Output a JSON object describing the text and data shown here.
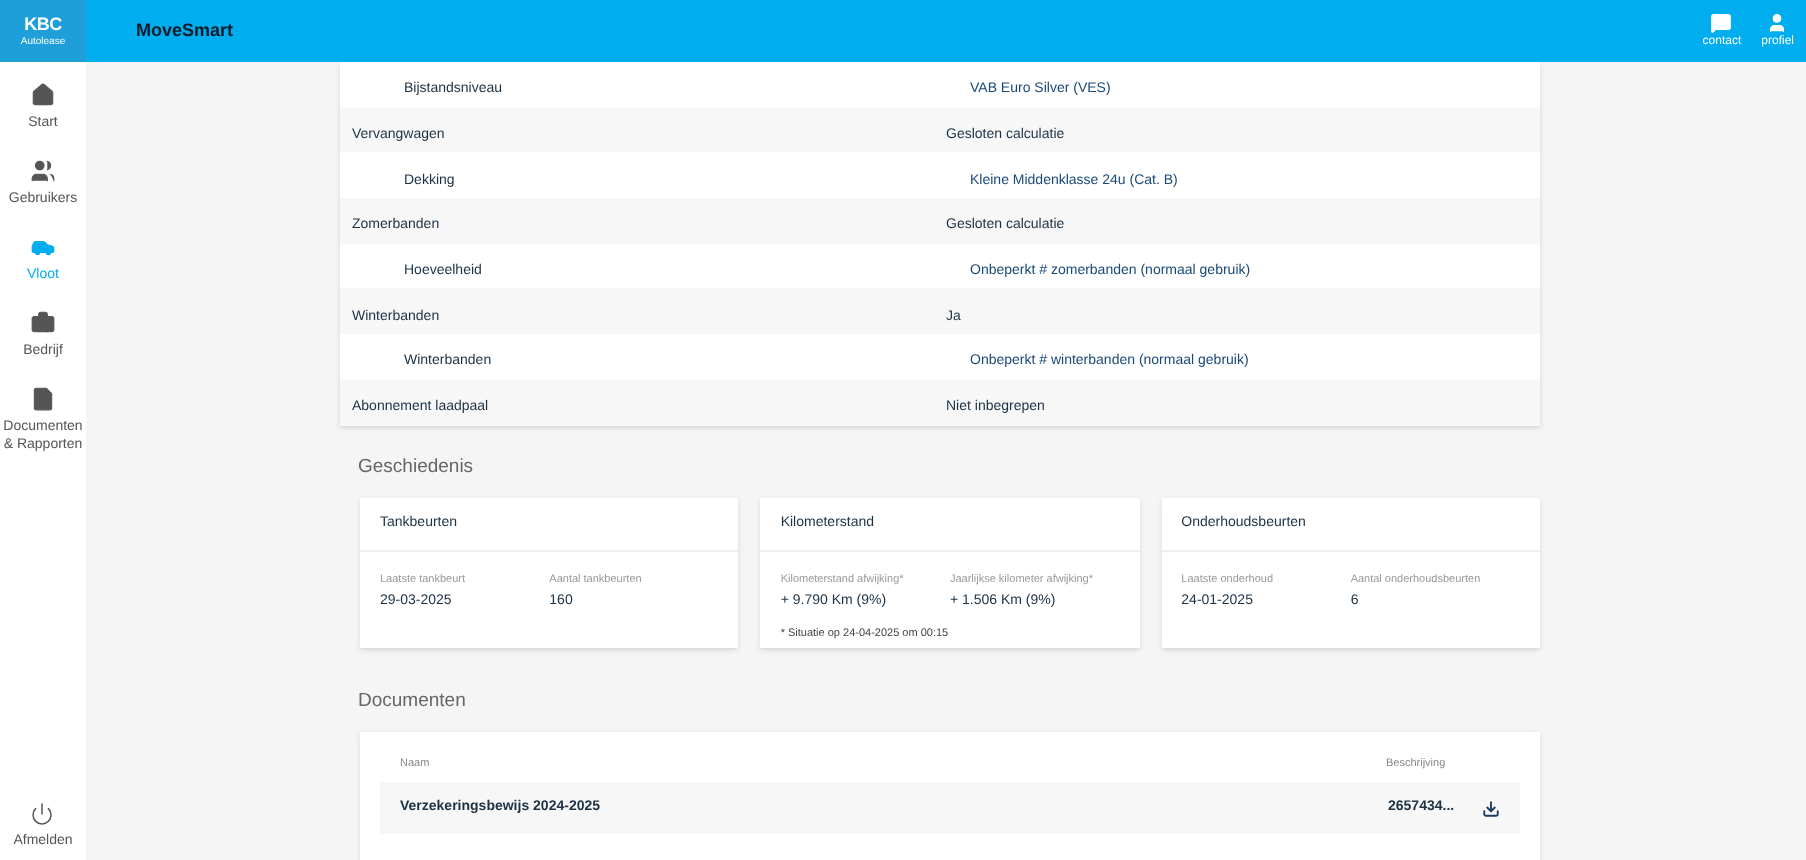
{
  "header": {
    "logo": {
      "name": "KBC",
      "subtitle": "Autolease"
    },
    "title": "MoveSmart",
    "actions": [
      {
        "label": "contact",
        "kind": "chat"
      },
      {
        "label": "profiel",
        "kind": "user"
      }
    ]
  },
  "sidebar": {
    "items": [
      {
        "label": "Start",
        "kind": "home",
        "selected": false
      },
      {
        "label": "Gebruikers",
        "kind": "users",
        "selected": false
      },
      {
        "label": "Vloot",
        "kind": "car",
        "selected": true
      },
      {
        "label": "Bedrijf",
        "kind": "briefcase",
        "selected": false
      },
      {
        "label": "Documenten & Rapporten",
        "kind": "document",
        "selected": false
      }
    ],
    "logout": {
      "label": "Afmelden"
    }
  },
  "details": {
    "rows": [
      {
        "children": [
          {
            "label": "Bijstandsniveau",
            "value": "VAB Euro Silver (VES)"
          }
        ]
      },
      {
        "label": "Vervangwagen",
        "value": "Gesloten calculatie",
        "children": [
          {
            "label": "Dekking",
            "value": "Kleine Middenklasse 24u (Cat. B)"
          }
        ]
      },
      {
        "label": "Zomerbanden",
        "value": "Gesloten calculatie",
        "children": [
          {
            "label": "Hoeveelheid",
            "value": "Onbeperkt # zomerbanden (normaal gebruik)"
          }
        ]
      },
      {
        "label": "Winterbanden",
        "value": "Ja",
        "children": [
          {
            "label": "Winterbanden",
            "value": "Onbeperkt # winterbanden (normaal gebruik)"
          }
        ]
      },
      {
        "label": "Abonnement laadpaal",
        "value": "Niet inbegrepen"
      }
    ]
  },
  "history": {
    "title": "Geschiedenis",
    "cards": [
      {
        "title": "Tankbeurten",
        "fields": [
          {
            "label": "Laatste tankbeurt",
            "value": "29-03-2025"
          },
          {
            "label": "Aantal tankbeurten",
            "value": "160"
          }
        ]
      },
      {
        "title": "Kilometerstand",
        "fields": [
          {
            "label": "Kilometerstand afwijking*",
            "value": "+ 9.790 Km (9%)"
          },
          {
            "label": "Jaarlijkse kilometer afwijking*",
            "value": "+ 1.506 Km (9%)"
          }
        ],
        "note": "* Situatie op 24-04-2025 om 00:15"
      },
      {
        "title": "Onderhoudsbeurten",
        "fields": [
          {
            "label": "Laatste onderhoud",
            "value": "24-01-2025"
          },
          {
            "label": "Aantal onderhoudsbeurten",
            "value": "6"
          }
        ]
      }
    ]
  },
  "documents": {
    "title": "Documenten",
    "columns": [
      "Naam",
      "Beschrijving"
    ],
    "rows": [
      {
        "name": "Verzekeringsbewijs 2024-2025",
        "description": "2657434..."
      }
    ]
  }
}
